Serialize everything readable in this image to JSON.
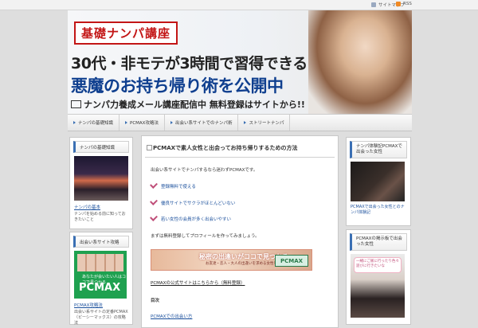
{
  "topbar": {
    "link1": "サイトマップ",
    "rss": "RSS"
  },
  "header": {
    "label": "基礎ナンパ講座",
    "catch1": "30代・非モテが3時間で習得できる",
    "catch2": "悪魔のお持ち帰り術を公開中",
    "catch3": "ナンパ力養成メール講座配信中 無料登録はサイトから!!"
  },
  "nav": {
    "items": [
      "ナンパの基礎知識",
      "PCMAX攻略法",
      "出会い系サイトでのナンパ術",
      "ストリートナンパ"
    ]
  },
  "left": {
    "w1": {
      "title": "ナンパの基礎知識",
      "link": "ナンパの基本",
      "desc": "ナンパを始める前に知っておきたいこと"
    },
    "w2": {
      "title": "出会い系サイト攻略",
      "img_title": "PCMAX",
      "img_sub": "あなたが会いたい人はココで見つかる",
      "link": "PCMAX攻略法",
      "desc": "出会い系サイトの定番PCMAX（ピーシーマックス）の攻略法"
    }
  },
  "post": {
    "title": "PCMAXで素人女性と出会ってお持ち帰りするための方法",
    "intro": "出会い系サイトでナンパするなら迷わずPCMAXです。",
    "checks": [
      "登録無料で使える",
      "優良サイトでサクラがほとんどいない",
      "若い女性の会員が多く出会いやすい"
    ],
    "line2": "まずは無料登録してプロフィールを作ってみましょう。",
    "banner_title": "秘密の出逢いがココで見つかる",
    "banner_sub": "お友達・恋人・大人の出逢いを求める女性をサポートします",
    "banner_logo": "PCMAX",
    "link1": "PCMAXの公式サイトはこちらから（無料登録）",
    "section": "目次",
    "link2": "PCMAXでの出会い方"
  },
  "right": {
    "w1": {
      "title": "ナンパ体験記PCMAXで出会った女性",
      "desc": "PCMAXで出会った女性とのナンパ体験記"
    },
    "w2": {
      "title": "PCMAXの掲示板で出会った女性",
      "bubble": "一緒にご飯に行ったり色々遊びに行きたいな"
    }
  },
  "colors": {
    "accent": "#3a6fb3",
    "red": "#c31616",
    "navy": "#0f3f8f",
    "pcmax_green": "#1fa150"
  }
}
